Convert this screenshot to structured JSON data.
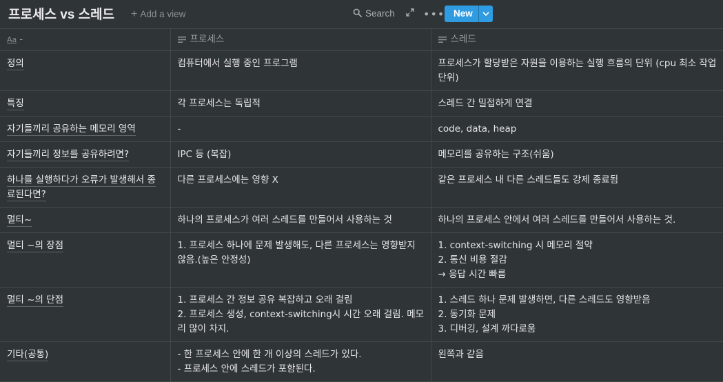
{
  "header": {
    "title": "프로세스 vs 스레드",
    "add_view": "Add a view",
    "search": "Search",
    "new_label": "New"
  },
  "icons": {
    "add": "plus-icon",
    "search": "search-icon",
    "expand": "expand-icon",
    "more": "more-icon",
    "dropdown": "chevron-down-icon",
    "title_prop": "title-property-icon",
    "text_prop": "text-property-icon"
  },
  "colors": {
    "background": "#2f3437",
    "accent": "#2f9be0",
    "border": "#44494c"
  },
  "table": {
    "columns": [
      {
        "icon_text": "Aa",
        "label": "-"
      },
      {
        "label": "프로세스"
      },
      {
        "label": "스레드"
      }
    ],
    "rows": [
      {
        "name": "정의",
        "process": "컴퓨터에서 실행 중인 프로그램",
        "thread": "프로세스가 할당받은 자원을 이용하는 실행 흐름의 단위 (cpu 최소 작업 단위)"
      },
      {
        "name": "특징",
        "process": "각 프로세스는 독립적",
        "thread": "스레드 간 밀접하게 연결"
      },
      {
        "name": "자기들끼리 공유하는 메모리 영역",
        "process": "-",
        "thread": "code, data, heap"
      },
      {
        "name": "자기들끼리 정보를 공유하려면?",
        "process": "IPC 등 (복잡)",
        "thread": "메모리를 공유하는 구조(쉬움)"
      },
      {
        "name": "하나를 실행하다가 오류가 발생해서 종료된다면?",
        "process": "다른 프로세스에는 영향 X",
        "thread": "같은 프로세스 내 다른 스레드들도 강제 종료됨"
      },
      {
        "name": "멀티~",
        "process": "하나의 프로세스가 여러 스레드를 만들어서 사용하는 것",
        "thread": "하나의 프로세스 안에서 여러 스레드를 만들어서 사용하는 것."
      },
      {
        "name": "멀티 ~의 장점",
        "process": "1. 프로세스 하나에 문제 발생해도, 다른 프로세스는 영향받지 않음.(높은 안정성)",
        "thread": "1. context-switching 시 메모리 절약\n2. 통신 비용 절감\n→ 응답 시간 빠름"
      },
      {
        "name": "멀티 ~의 단점",
        "process": "1. 프로세스 간 정보 공유 복잡하고 오래 걸림\n2. 프로세스 생성, context-switching시 시간 오래 걸림. 메모리 많이 차지.",
        "thread": "1. 스레드 하나 문제 발생하면, 다른 스레드도 영향받음\n2. 동기화 문제\n3. 디버깅, 설계 까다로움"
      },
      {
        "name": "기타(공통)",
        "process": "- 한 프로세스 안에 한 개 이상의 스레드가 있다.\n- 프로세스 안에 스레드가 포함된다.",
        "thread": "왼쪽과 같음"
      }
    ]
  }
}
